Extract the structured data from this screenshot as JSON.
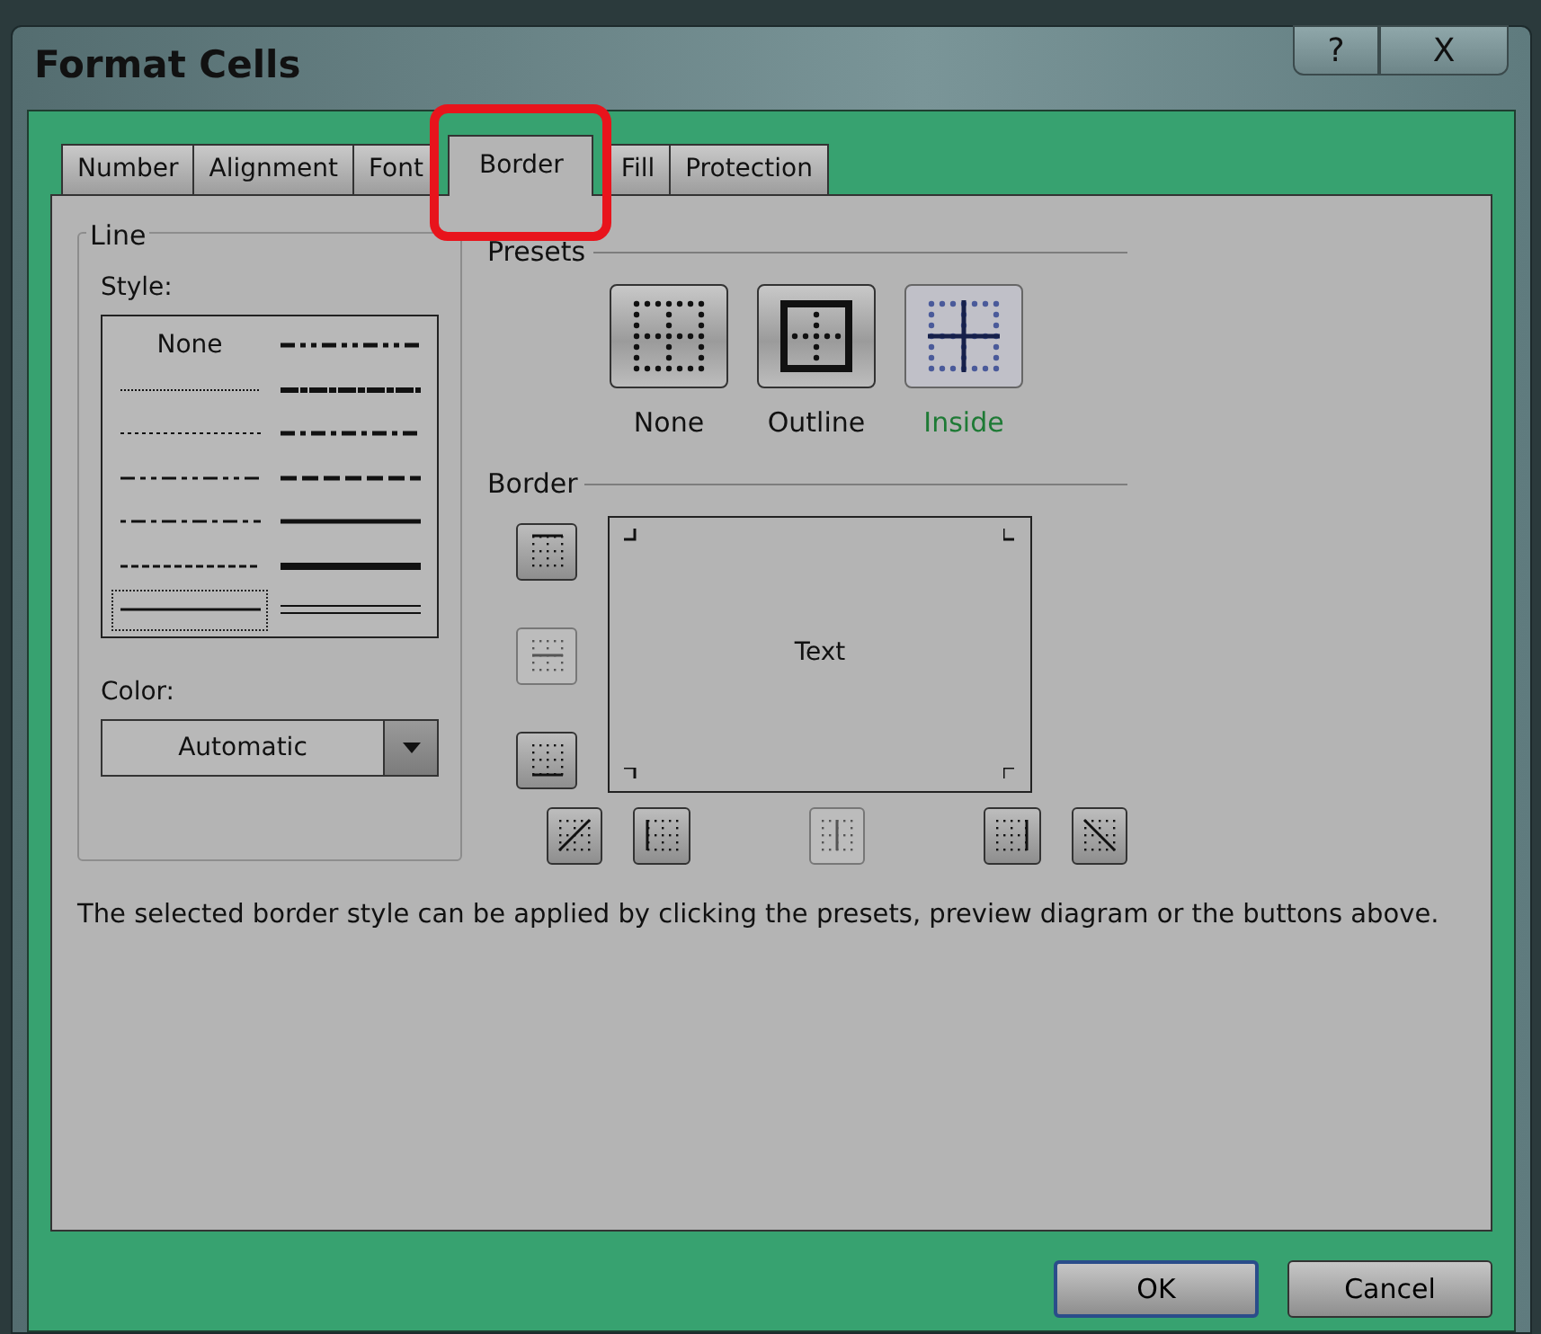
{
  "window": {
    "title": "Format Cells",
    "help_glyph": "?",
    "close_glyph": "X"
  },
  "tabs": [
    {
      "label": "Number",
      "selected": false,
      "highlighted": false
    },
    {
      "label": "Alignment",
      "selected": false,
      "highlighted": false
    },
    {
      "label": "Font",
      "selected": false,
      "highlighted": false
    },
    {
      "label": "Border",
      "selected": true,
      "highlighted": true
    },
    {
      "label": "Fill",
      "selected": false,
      "highlighted": false
    },
    {
      "label": "Protection",
      "selected": false,
      "highlighted": false
    }
  ],
  "line": {
    "title": "Line",
    "style_label": "Style:",
    "styles_left": [
      {
        "kind": "none",
        "label": "None",
        "selected": false
      },
      {
        "kind": "hair",
        "selected": false
      },
      {
        "kind": "dotted",
        "selected": false
      },
      {
        "kind": "dashdotdot",
        "selected": false
      },
      {
        "kind": "dashdot",
        "selected": false
      },
      {
        "kind": "dashed",
        "selected": false
      },
      {
        "kind": "thin",
        "selected": true
      }
    ],
    "styles_right": [
      {
        "kind": "mdashdotdot",
        "selected": false
      },
      {
        "kind": "slanted",
        "selected": false
      },
      {
        "kind": "mdashdot",
        "selected": false
      },
      {
        "kind": "mdashed",
        "selected": false
      },
      {
        "kind": "medium",
        "selected": false
      },
      {
        "kind": "thick",
        "selected": false
      },
      {
        "kind": "double",
        "selected": false
      }
    ],
    "color_label": "Color:",
    "color_value": "Automatic"
  },
  "presets": {
    "title": "Presets",
    "items": [
      {
        "kind": "none",
        "label": "None",
        "highlighted": false
      },
      {
        "kind": "outline",
        "label": "Outline",
        "highlighted": false
      },
      {
        "kind": "inside",
        "label": "Inside",
        "highlighted": true
      }
    ]
  },
  "border": {
    "title": "Border",
    "preview_text": "Text",
    "side_buttons": [
      {
        "kind": "top",
        "disabled": false
      },
      {
        "kind": "hmiddle",
        "disabled": true
      },
      {
        "kind": "bottom",
        "disabled": false
      }
    ],
    "bottom_buttons": [
      {
        "kind": "diagup",
        "disabled": false
      },
      {
        "kind": "left",
        "disabled": false
      },
      {
        "kind": "vmiddle",
        "disabled": true
      },
      {
        "kind": "right",
        "disabled": false
      },
      {
        "kind": "diagdown",
        "disabled": false
      }
    ]
  },
  "hint": "The selected border style can be applied by clicking the presets, preview diagram or the buttons above.",
  "buttons": [
    {
      "label": "OK",
      "default": true
    },
    {
      "label": "Cancel",
      "default": false
    }
  ]
}
